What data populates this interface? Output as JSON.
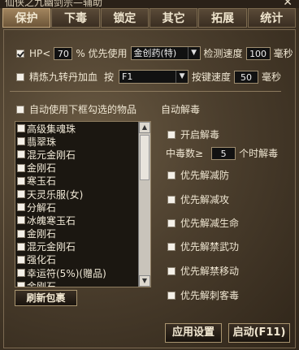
{
  "window": {
    "title": "仙侠之九幽剑宗—辅助",
    "close_glyph": "✕"
  },
  "tabs": [
    "保护",
    "下毒",
    "锁定",
    "其它",
    "拓展",
    "统计"
  ],
  "hp": {
    "prefix": "HP<",
    "value": "70",
    "suffix": "% 优先使用",
    "item": "金创药(特)",
    "detect_label": "检测速度",
    "detect_value": "100",
    "unit": "毫秒"
  },
  "refine": {
    "label": "精炼九转丹加血",
    "key_label": "按",
    "key": "F1",
    "press_label": "按键速度",
    "press_value": "50",
    "unit": "毫秒"
  },
  "auto_items": {
    "label": "自动使用下框勾选的物品",
    "items": [
      "高级集魂珠",
      "翡翠珠",
      "混元金刚石",
      "金刚石",
      "寒玉石",
      "天灵乐服(女)",
      "分解石",
      "冰魄寒玉石",
      "金刚石",
      "混元金刚石",
      "强化石",
      "幸运符(5%)(赠品)",
      "金刚石"
    ]
  },
  "detox": {
    "heading": "自动解毒",
    "enable": "开启解毒",
    "count_prefix": "中毒数≥",
    "count_value": "5",
    "count_suffix": "个时解毒",
    "options": [
      "优先解减防",
      "优先解减攻",
      "优先解减生命",
      "优先解禁武功",
      "优先解禁移动",
      "优先解刺客毒"
    ]
  },
  "buttons": {
    "refresh": "刷新包裹",
    "apply": "应用设置",
    "start": "启动(F11)"
  }
}
